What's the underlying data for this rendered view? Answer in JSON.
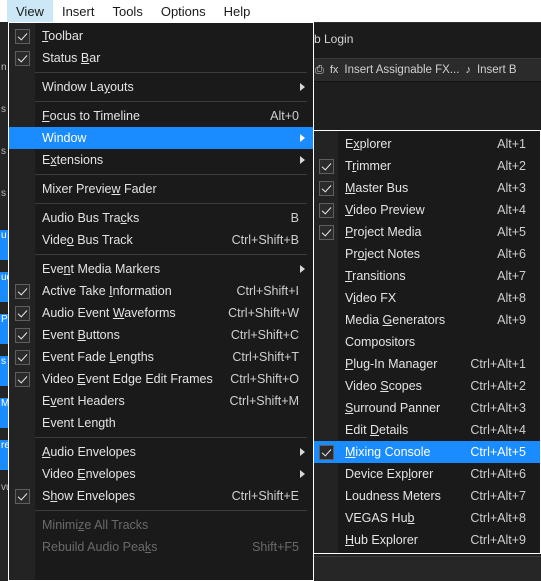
{
  "app": {
    "background": {
      "login_text": "b Login",
      "toolbar_items": [
        {
          "icon": "insert-video-envelope-icon",
          "glyph": "⎙",
          "label": ""
        },
        {
          "icon": "insert-fx-icon",
          "glyph": "fx",
          "label": "Insert Assignable FX..."
        },
        {
          "icon": "insert-bus-icon",
          "glyph": "♪",
          "label": "Insert B"
        }
      ],
      "left_strip_rows": [
        {
          "text": "n",
          "selected": false
        },
        {
          "text": "s",
          "selected": false
        },
        {
          "text": "s",
          "selected": false
        },
        {
          "text": "s",
          "selected": false
        },
        {
          "text": "u",
          "selected": true
        },
        {
          "text": "uc",
          "selected": true
        },
        {
          "text": "P",
          "selected": true
        },
        {
          "text": "s",
          "selected": true
        },
        {
          "text": "Ma",
          "selected": true
        },
        {
          "text": "re",
          "selected": true
        },
        {
          "text": "vu",
          "selected": false
        }
      ]
    }
  },
  "menubar": {
    "items": [
      {
        "label": "View",
        "active": true
      },
      {
        "label": "Insert",
        "active": false
      },
      {
        "label": "Tools",
        "active": false
      },
      {
        "label": "Options",
        "active": false
      },
      {
        "label": "Help",
        "active": false
      }
    ]
  },
  "view_menu": {
    "items": [
      {
        "type": "item",
        "label": "Toolbar",
        "mnemonic": "T",
        "accel": "",
        "checked": true,
        "submenu": false,
        "disabled": false,
        "selected": false
      },
      {
        "type": "item",
        "label": "Status Bar",
        "mnemonic": "B",
        "accel": "",
        "checked": true,
        "submenu": false,
        "disabled": false,
        "selected": false
      },
      {
        "type": "separator"
      },
      {
        "type": "item",
        "label": "Window Layouts",
        "mnemonic": "y",
        "accel": "",
        "checked": false,
        "submenu": true,
        "disabled": false,
        "selected": false
      },
      {
        "type": "separator"
      },
      {
        "type": "item",
        "label": "Focus to Timeline",
        "mnemonic": "F",
        "accel": "Alt+0",
        "checked": false,
        "submenu": false,
        "disabled": false,
        "selected": false
      },
      {
        "type": "item",
        "label": "Window",
        "mnemonic": "",
        "accel": "",
        "checked": false,
        "submenu": true,
        "disabled": false,
        "selected": true
      },
      {
        "type": "item",
        "label": "Extensions",
        "mnemonic": "x",
        "accel": "",
        "checked": false,
        "submenu": true,
        "disabled": false,
        "selected": false
      },
      {
        "type": "separator"
      },
      {
        "type": "item",
        "label": "Mixer Preview Fader",
        "mnemonic": "w",
        "accel": "",
        "checked": false,
        "submenu": false,
        "disabled": false,
        "selected": false
      },
      {
        "type": "separator"
      },
      {
        "type": "item",
        "label": "Audio Bus Tracks",
        "mnemonic": "c",
        "accel": "B",
        "checked": false,
        "submenu": false,
        "disabled": false,
        "selected": false
      },
      {
        "type": "item",
        "label": "Video Bus Track",
        "mnemonic": "o",
        "accel": "Ctrl+Shift+B",
        "checked": false,
        "submenu": false,
        "disabled": false,
        "selected": false
      },
      {
        "type": "separator"
      },
      {
        "type": "item",
        "label": "Event Media Markers",
        "mnemonic": "n",
        "accel": "",
        "checked": false,
        "submenu": true,
        "disabled": false,
        "selected": false
      },
      {
        "type": "item",
        "label": "Active Take Information",
        "mnemonic": "I",
        "accel": "Ctrl+Shift+I",
        "checked": true,
        "submenu": false,
        "disabled": false,
        "selected": false
      },
      {
        "type": "item",
        "label": "Audio Event Waveforms",
        "mnemonic": "W",
        "accel": "Ctrl+Shift+W",
        "checked": true,
        "submenu": false,
        "disabled": false,
        "selected": false
      },
      {
        "type": "item",
        "label": "Event Buttons",
        "mnemonic": "B",
        "accel": "Ctrl+Shift+C",
        "checked": true,
        "submenu": false,
        "disabled": false,
        "selected": false
      },
      {
        "type": "item",
        "label": "Event Fade Lengths",
        "mnemonic": "L",
        "accel": "Ctrl+Shift+T",
        "checked": true,
        "submenu": false,
        "disabled": false,
        "selected": false
      },
      {
        "type": "item",
        "label": "Video Event Edge Edit Frames",
        "mnemonic": "E",
        "accel": "Ctrl+Shift+O",
        "checked": true,
        "submenu": false,
        "disabled": false,
        "selected": false
      },
      {
        "type": "item",
        "label": "Event Headers",
        "mnemonic": "v",
        "accel": "Ctrl+Shift+M",
        "checked": false,
        "submenu": false,
        "disabled": false,
        "selected": false
      },
      {
        "type": "item",
        "label": "Event Length",
        "mnemonic": "",
        "accel": "",
        "checked": false,
        "submenu": false,
        "disabled": false,
        "selected": false
      },
      {
        "type": "separator"
      },
      {
        "type": "item",
        "label": "Audio Envelopes",
        "mnemonic": "A",
        "accel": "",
        "checked": false,
        "submenu": true,
        "disabled": false,
        "selected": false
      },
      {
        "type": "item",
        "label": "Video Envelopes",
        "mnemonic": "E",
        "accel": "",
        "checked": false,
        "submenu": true,
        "disabled": false,
        "selected": false
      },
      {
        "type": "item",
        "label": "Show Envelopes",
        "mnemonic": "h",
        "accel": "Ctrl+Shift+E",
        "checked": true,
        "submenu": false,
        "disabled": false,
        "selected": false
      },
      {
        "type": "separator"
      },
      {
        "type": "item",
        "label": "Minimize All Tracks",
        "mnemonic": "z",
        "accel": "",
        "checked": false,
        "submenu": false,
        "disabled": true,
        "selected": false
      },
      {
        "type": "item",
        "label": "Rebuild Audio Peaks",
        "mnemonic": "k",
        "accel": "Shift+F5",
        "checked": false,
        "submenu": false,
        "disabled": true,
        "selected": false
      }
    ]
  },
  "window_submenu": {
    "items": [
      {
        "type": "item",
        "label": "Explorer",
        "mnemonic": "x",
        "accel": "Alt+1",
        "checked": false,
        "selected": false
      },
      {
        "type": "item",
        "label": "Trimmer",
        "mnemonic": "r",
        "accel": "Alt+2",
        "checked": true,
        "selected": false
      },
      {
        "type": "item",
        "label": "Master Bus",
        "mnemonic": "M",
        "accel": "Alt+3",
        "checked": true,
        "selected": false
      },
      {
        "type": "item",
        "label": "Video Preview",
        "mnemonic": "V",
        "accel": "Alt+4",
        "checked": true,
        "selected": false
      },
      {
        "type": "item",
        "label": "Project Media",
        "mnemonic": "P",
        "accel": "Alt+5",
        "checked": true,
        "selected": false
      },
      {
        "type": "item",
        "label": "Project Notes",
        "mnemonic": "o",
        "accel": "Alt+6",
        "checked": false,
        "selected": false
      },
      {
        "type": "item",
        "label": "Transitions",
        "mnemonic": "T",
        "accel": "Alt+7",
        "checked": false,
        "selected": false
      },
      {
        "type": "item",
        "label": "Video FX",
        "mnemonic": "i",
        "accel": "Alt+8",
        "checked": false,
        "selected": false
      },
      {
        "type": "item",
        "label": "Media Generators",
        "mnemonic": "G",
        "accel": "Alt+9",
        "checked": false,
        "selected": false
      },
      {
        "type": "item",
        "label": "Compositors",
        "mnemonic": "",
        "accel": "",
        "checked": false,
        "selected": false
      },
      {
        "type": "item",
        "label": "Plug-In Manager",
        "mnemonic": "P",
        "accel": "Ctrl+Alt+1",
        "checked": false,
        "selected": false
      },
      {
        "type": "item",
        "label": "Video Scopes",
        "mnemonic": "S",
        "accel": "Ctrl+Alt+2",
        "checked": false,
        "selected": false
      },
      {
        "type": "item",
        "label": "Surround Panner",
        "mnemonic": "S",
        "accel": "Ctrl+Alt+3",
        "checked": false,
        "selected": false
      },
      {
        "type": "item",
        "label": "Edit Details",
        "mnemonic": "D",
        "accel": "Ctrl+Alt+4",
        "checked": false,
        "selected": false
      },
      {
        "type": "item",
        "label": "Mixing Console",
        "mnemonic": "M",
        "accel": "Ctrl+Alt+5",
        "checked": true,
        "selected": true
      },
      {
        "type": "item",
        "label": "Device Explorer",
        "mnemonic": "l",
        "accel": "Ctrl+Alt+6",
        "checked": false,
        "selected": false
      },
      {
        "type": "item",
        "label": "Loudness Meters",
        "mnemonic": "",
        "accel": "Ctrl+Alt+7",
        "checked": false,
        "selected": false
      },
      {
        "type": "item",
        "label": "VEGAS Hub",
        "mnemonic": "b",
        "accel": "Ctrl+Alt+8",
        "checked": false,
        "selected": false
      },
      {
        "type": "item",
        "label": "Hub Explorer",
        "mnemonic": "H",
        "accel": "Ctrl+Alt+9",
        "checked": false,
        "selected": false
      }
    ]
  },
  "colors": {
    "menu_bg": "#1a1a1a",
    "menu_border": "#ffffff",
    "gutter": "#232323",
    "highlight": "#1a8cff",
    "menubar_bg": "#ffffff",
    "menubar_active": "#cce8f7",
    "text": "#e4e4e4",
    "text_disabled": "#6a6a6a"
  }
}
